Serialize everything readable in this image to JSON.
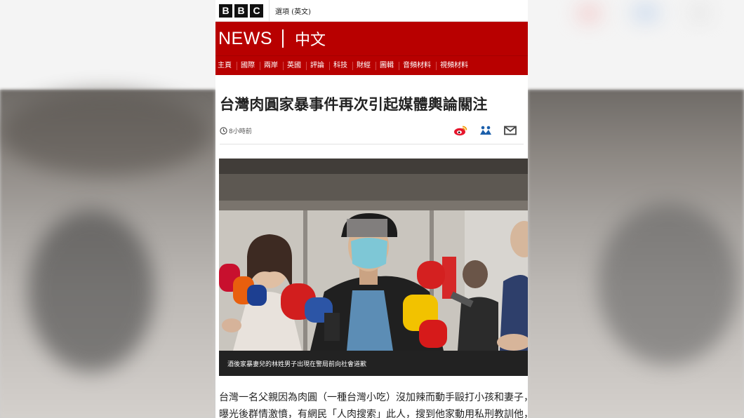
{
  "bbc": {
    "logo_letters": [
      "B",
      "B",
      "C"
    ],
    "options_label": "選項 (英文)"
  },
  "header": {
    "brand": "NEWS",
    "language": "中文"
  },
  "nav": {
    "items": [
      "主頁",
      "國際",
      "兩岸",
      "英國",
      "評論",
      "科技",
      "財經",
      "圖輯",
      "音頻材料",
      "視頻材料"
    ]
  },
  "article": {
    "headline": "台灣肉圓家暴事件再次引起媒體輿論關注",
    "timestamp": "8小時前",
    "caption": "酒後家暴妻兒的林姓男子出現在警局前向社會道歉",
    "body_line1": "台灣一名父親因為肉圓（一種台灣小吃）沒加辣而動手毆打小孩和妻子，家暴影片",
    "body_line2": "曝光後群情激憤，有網民「人肉搜索」此人，搜到他家動用私刑教訓他，但以暴制"
  },
  "share": {
    "icons": [
      "weibo-icon",
      "qzone-icon",
      "email-icon"
    ]
  },
  "colors": {
    "brand_red": "#b80000",
    "caption_bg": "#222222",
    "weibo_red": "#e6162d",
    "qzone_blue": "#1b5fab"
  }
}
